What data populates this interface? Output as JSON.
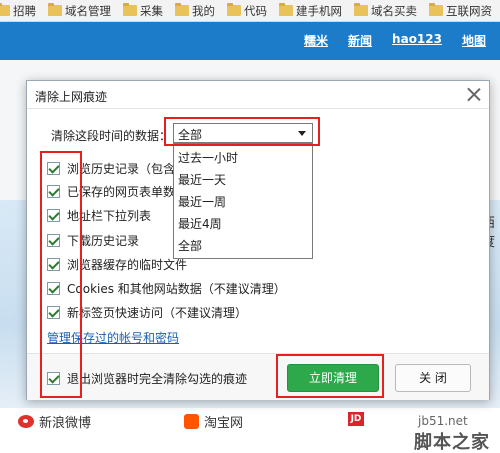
{
  "bookmarks_bar": {
    "items": [
      "招聘",
      "域名管理",
      "采集",
      "我的",
      "代码",
      "建手机网",
      "域名买卖",
      "互联网资"
    ]
  },
  "page_nav": {
    "links": [
      "糯米",
      "新闻",
      "hao123",
      "地图"
    ]
  },
  "page_edge_text": "西度",
  "bottom_links": {
    "weibo": "新浪微博",
    "taobao": "淘宝网",
    "jd_badge": "JD"
  },
  "watermark": {
    "url": "jb51.net",
    "name": "脚本之家"
  },
  "dialog": {
    "title": "清除上网痕迹",
    "range_label": "清除这段时间的数据：",
    "range_select": {
      "value": "全部",
      "options": [
        "过去一小时",
        "最近一天",
        "最近一周",
        "最近4周",
        "全部"
      ]
    },
    "options": [
      {
        "label": "浏览历史记录（包含",
        "checked": true
      },
      {
        "label": "已保存的网页表单数",
        "checked": true
      },
      {
        "label": "地址栏下拉列表",
        "checked": true
      },
      {
        "label": "下载历史记录",
        "checked": true
      },
      {
        "label": "浏览器缓存的临时文件",
        "checked": true
      },
      {
        "label": "Cookies 和其他网站数据（不建议清理）",
        "checked": true
      },
      {
        "label": "新标签页快速访问（不建议清理）",
        "checked": true
      }
    ],
    "manage_link": "管理保存过的帐号和密码",
    "exit_option": {
      "label": "退出浏览器时完全清除勾选的痕迹",
      "checked": true
    },
    "clear_button": "立即清理",
    "close_button": "关 闭"
  },
  "colors": {
    "header_blue": "#1c7cc9",
    "clear_button_green": "#2da94b",
    "annotation_red": "#e62020",
    "link_blue": "#1a5fb4"
  }
}
